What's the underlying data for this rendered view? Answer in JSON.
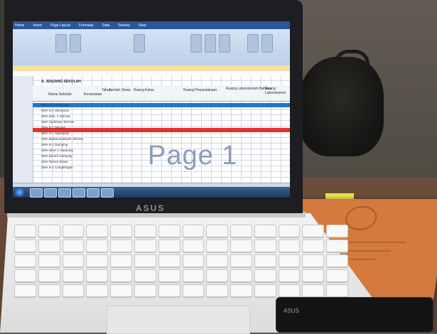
{
  "scene": {
    "laptop_brand": "ASUS",
    "screen": {
      "app": "spreadsheet",
      "ribbon_tabs": [
        "Home",
        "Insert",
        "Page Layout",
        "Formulas",
        "Data",
        "Review",
        "View"
      ],
      "sheet_title": "A. JENJANG SEKOLAH",
      "columns": [
        "Nama Sekolah",
        "Kecamatan",
        "Tahun",
        "Jumlah Siswa",
        "Ruang Kelas",
        "Ruang Perpustakaan",
        "Ruang Laboratorium Bahasa",
        "Ruang Laboratorium"
      ],
      "highlight_colors": {
        "blue_row": "#1f78c8",
        "red_row": "#e5322c"
      },
      "rows": [
        "SMA N 1 Slemanan",
        "SMA N 2 Slemanan",
        "SMA Muh. 1 Sleman",
        "SMA Sudirman Sleman",
        "SMA N 1 Mergan",
        "SMA N 1 Ngemplak",
        "SMA Muhammadiyah Sleman",
        "SMA N 2 Gamping",
        "SMA Islam 1 Gamping",
        "SMA Ma'arif Gamping",
        "SMA Taman Siswa",
        "SMA N 1 Cangkringan"
      ],
      "watermark": "Page 1"
    },
    "sticker": "ASUS"
  }
}
